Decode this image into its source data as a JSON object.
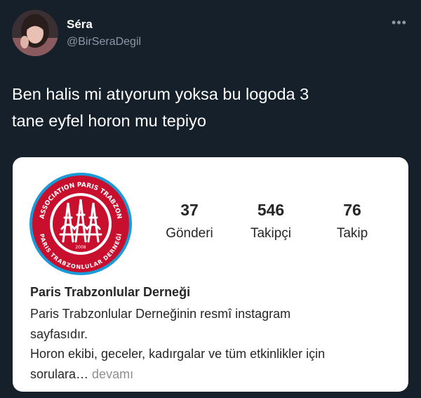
{
  "tweet": {
    "display_name": "Séra",
    "handle": "@BirSeraDegil",
    "text_line1": "Ben halis mi atıyorum yoksa bu logoda 3",
    "text_line2": "tane eyfel horon mu tepiyo"
  },
  "colors": {
    "background": "#15202b",
    "card": "#ffffff",
    "logo_red": "#c8102e",
    "logo_blue": "#1a9ad6"
  },
  "icons": {
    "more": "more-dots-icon"
  },
  "embed": {
    "logo": {
      "ring_text_top": "ASSOCIATION PARIS TRABZON",
      "ring_text_bottom": "PARIS TRABZONLULAR DERNEĞİ",
      "year": "2008"
    },
    "stats": [
      {
        "value": "37",
        "label": "Gönderi"
      },
      {
        "value": "546",
        "label": "Takipçi"
      },
      {
        "value": "76",
        "label": "Takip"
      }
    ],
    "profile_name": "Paris Trabzonlular Derneği",
    "bio_line1": "Paris Trabzonlular Derneğinin resmî instagram",
    "bio_line2": "sayfasıdır.",
    "bio_line3": "Horon ekibi, geceler, kadırgalar ve tüm etkinlikler için",
    "bio_line4": "sorulara…",
    "more_label": "devamı"
  }
}
